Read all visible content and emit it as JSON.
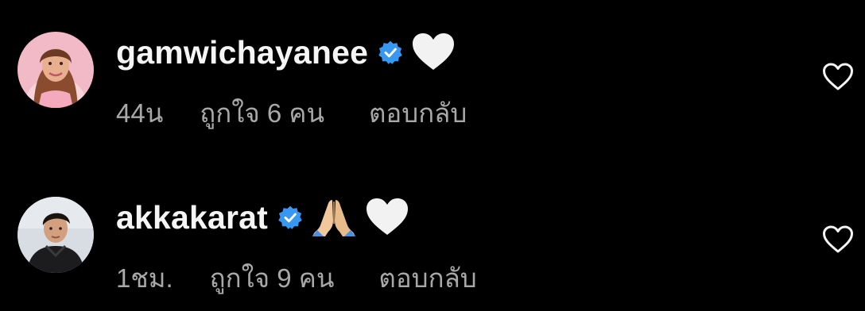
{
  "comments": [
    {
      "username": "gamwichayanee",
      "verified": true,
      "emojis": [
        "white-heart"
      ],
      "time": "44น",
      "likes": "ถูกใจ 6 คน",
      "reply_label": "ตอบกลับ"
    },
    {
      "username": "akkakarat",
      "verified": true,
      "emojis": [
        "folded-hands",
        "white-heart"
      ],
      "time": "1ชม.",
      "likes": "ถูกใจ 9 คน",
      "reply_label": "ตอบกลับ"
    }
  ],
  "colors": {
    "background": "#000000",
    "primary_text": "#f5f5f5",
    "secondary_text": "#a8a8a8",
    "verified_blue": "#3897f0"
  }
}
